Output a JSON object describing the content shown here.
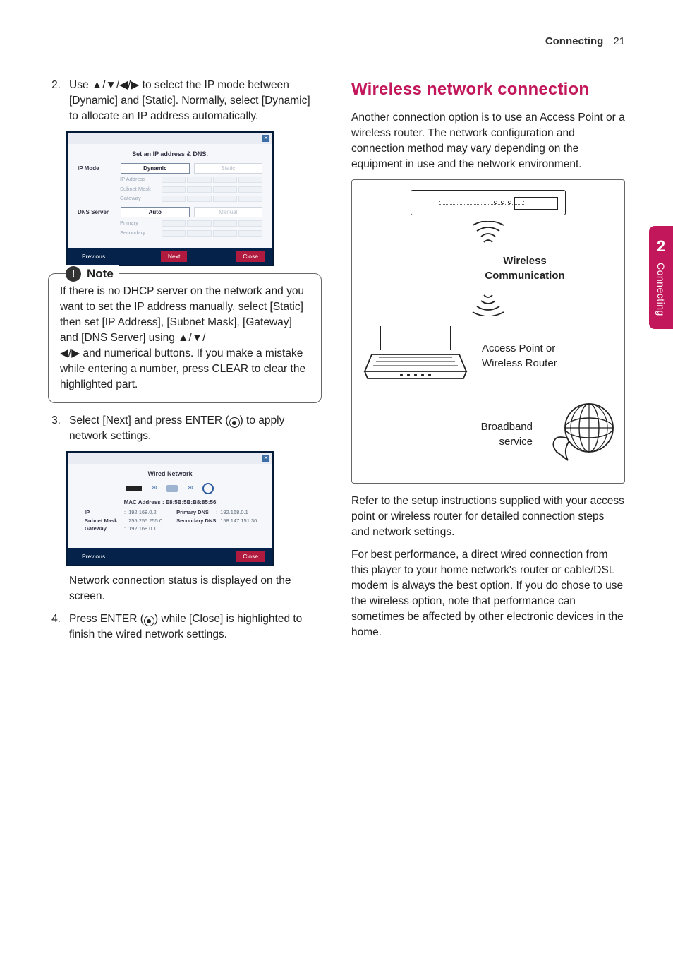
{
  "header": {
    "section": "Connecting",
    "page": "21"
  },
  "sideTab": {
    "num": "2",
    "label": "Connecting"
  },
  "left": {
    "step2": {
      "num": "2.",
      "text_a": "Use ",
      "arrows": "▲/▼/◀/▶",
      "text_b": " to select the IP mode between [Dynamic] and [Static]. Normally, select [Dynamic] to allocate an IP address automatically."
    },
    "scr1": {
      "title": "Set an IP address & DNS.",
      "ipmode_label": "IP Mode",
      "dynamic": "Dynamic",
      "static": "Static",
      "ipaddress": "IP Address",
      "subnet": "Subnet Mask",
      "gateway": "Gateway",
      "dns_label": "DNS Server",
      "auto": "Auto",
      "manual": "Manual",
      "primary": "Primary",
      "secondary": "Secondary",
      "prev": "Previous",
      "next": "Next",
      "close": "Close"
    },
    "note": {
      "label": "Note",
      "body_a": "If there is no DHCP server on the network and you want to set the IP address manually, select [Static] then set [IP Address], [Subnet Mask], [Gateway] and [DNS Server] using ",
      "arrows1": "▲/▼/",
      "arrows2": "◀/▶",
      "body_b": " and numerical buttons. If you make a mistake while entering a number, press CLEAR to clear the highlighted part."
    },
    "step3": {
      "num": "3.",
      "text_a": "Select [Next] and press ENTER (",
      "text_b": ") to apply network settings."
    },
    "scr2": {
      "title": "Wired Network",
      "mac_label": "MAC Address :",
      "mac": "E8:5B:5B:B8:85:56",
      "ip_k": "IP",
      "ip_v": "192.168.0.2",
      "sm_k": "Subnet Mask",
      "sm_v": "255.255.255.0",
      "gw_k": "Gateway",
      "gw_v": "192.168.0.1",
      "pd_k": "Primary DNS",
      "pd_v": "192.168.0.1",
      "sd_k": "Secondary DNS",
      "sd_v": "158.147.151.30",
      "prev": "Previous",
      "close": "Close"
    },
    "step3_caption": "Network connection status is displayed on the screen.",
    "step4": {
      "num": "4.",
      "text_a": "Press ENTER (",
      "text_b": ") while [Close] is highlighted to finish the wired network settings."
    }
  },
  "right": {
    "heading": "Wireless network connection",
    "para1": "Another connection option is to use an Access Point or a wireless router. The network configuration and connection method may vary depending on the equipment in use and the network environment.",
    "diagram": {
      "wc_line1": "Wireless",
      "wc_line2": "Communication",
      "ap_line1": "Access Point or",
      "ap_line2": "Wireless Router",
      "bb_line1": "Broadband",
      "bb_line2": "service"
    },
    "para2": "Refer to the setup instructions supplied with your access point or wireless router for detailed connection steps and network settings.",
    "para3": "For best performance, a direct wired connection from this player to your home network's router or cable/DSL modem is always the best option. If you do chose to use the wireless option, note that performance can sometimes be affected by other electronic devices in the home."
  }
}
